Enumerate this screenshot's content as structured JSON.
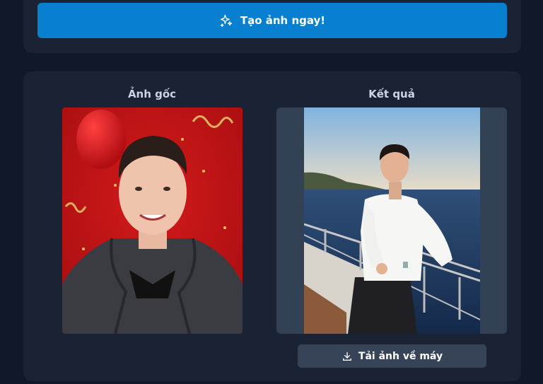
{
  "actions": {
    "generate_label": "Tạo ảnh ngay!",
    "download_label": "Tải ảnh về máy"
  },
  "columns": {
    "original_title": "Ảnh gốc",
    "result_title": "Kết quả"
  },
  "colors": {
    "accent": "#0880cf",
    "card": "#1a2333",
    "background": "#111827"
  },
  "icons": {
    "generate": "sparkles-icon",
    "download": "download-icon"
  }
}
